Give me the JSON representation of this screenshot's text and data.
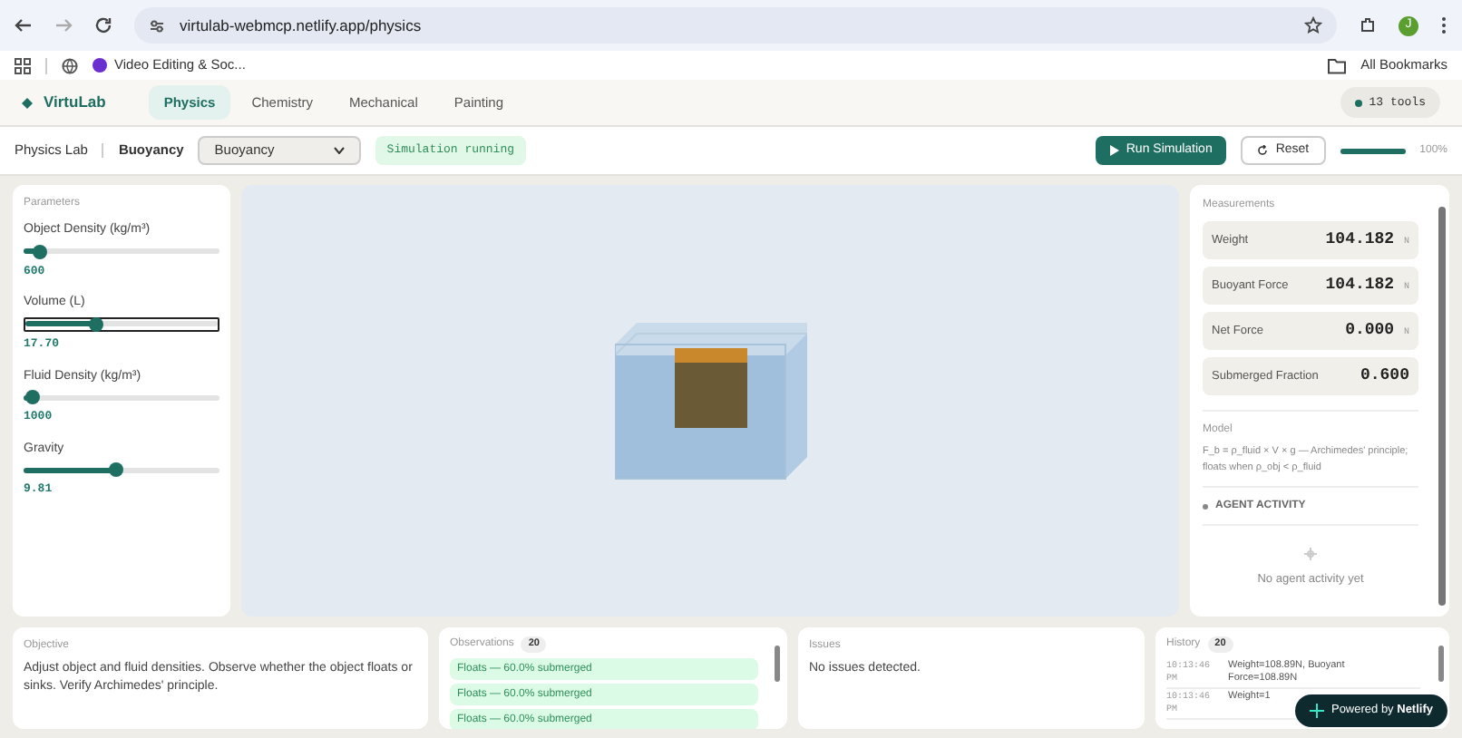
{
  "browser": {
    "url": "virtulab-webmcp.netlify.app/physics",
    "profile_initial": "J",
    "bookmarks": [
      "Video Editing & Soc..."
    ],
    "all_bookmarks": "All Bookmarks"
  },
  "nav": {
    "logo": "VirtuLab",
    "tabs": [
      {
        "label": "Physics",
        "selected": true
      },
      {
        "label": "Chemistry",
        "selected": false
      },
      {
        "label": "Mechanical",
        "selected": false
      },
      {
        "label": "Painting",
        "selected": false
      }
    ],
    "tools_badge": "13 tools"
  },
  "toolbar": {
    "breadcrumb": [
      "Physics Lab",
      "Buoyancy"
    ],
    "experiment_select": "Buoyancy",
    "status": "Simulation running",
    "run_button": "Run Simulation",
    "reset_button": "Reset",
    "progress": {
      "level": 1,
      "reading": "100%"
    }
  },
  "parameters": {
    "title": "Parameters",
    "sliders": [
      {
        "label": "Object Density (kg/m³)",
        "value": "600",
        "level": 0.08,
        "focused": false
      },
      {
        "label": "Volume (L)",
        "value": "17.70",
        "level": 0.37,
        "focused": true
      },
      {
        "label": "Fluid Density (kg/m³)",
        "value": "1000",
        "level": 0.05,
        "focused": false
      },
      {
        "label": "Gravity",
        "value": "9.81",
        "level": 0.47,
        "focused": false
      }
    ]
  },
  "measurements": {
    "title": "Measurements",
    "items": [
      {
        "label": "Weight",
        "value": "104.182",
        "unit": "N"
      },
      {
        "label": "Buoyant Force",
        "value": "104.182",
        "unit": "N"
      },
      {
        "label": "Net Force",
        "value": "0.000",
        "unit": "N"
      },
      {
        "label": "Submerged Fraction",
        "value": "0.600"
      }
    ],
    "model_title": "Model",
    "model_text": "F_b = ρ_fluid × V × g — Archimedes' principle; floats when ρ_obj < ρ_fluid",
    "agent_title": "AGENT ACTIVITY",
    "agent_empty": "No agent activity yet"
  },
  "objective": {
    "title": "Objective",
    "text": "Adjust object and fluid densities. Observe whether the object floats or sinks. Verify Archimedes' principle."
  },
  "observations": {
    "title": "Observations",
    "count": "20",
    "items": [
      "Floats — 60.0% submerged",
      "Floats — 60.0% submerged",
      "Floats — 60.0% submerged"
    ]
  },
  "issues": {
    "title": "Issues",
    "text": "No issues detected."
  },
  "history": {
    "title": "History",
    "count": "20",
    "items": [
      {
        "time": "10:13:46 PM",
        "text": "Weight=108.89N, Buoyant Force=108.89N"
      },
      {
        "time": "10:13:46 PM",
        "text": "Weight=1"
      }
    ]
  },
  "netlify_badge": {
    "prefix": "Powered by",
    "brand": "Netlify"
  }
}
